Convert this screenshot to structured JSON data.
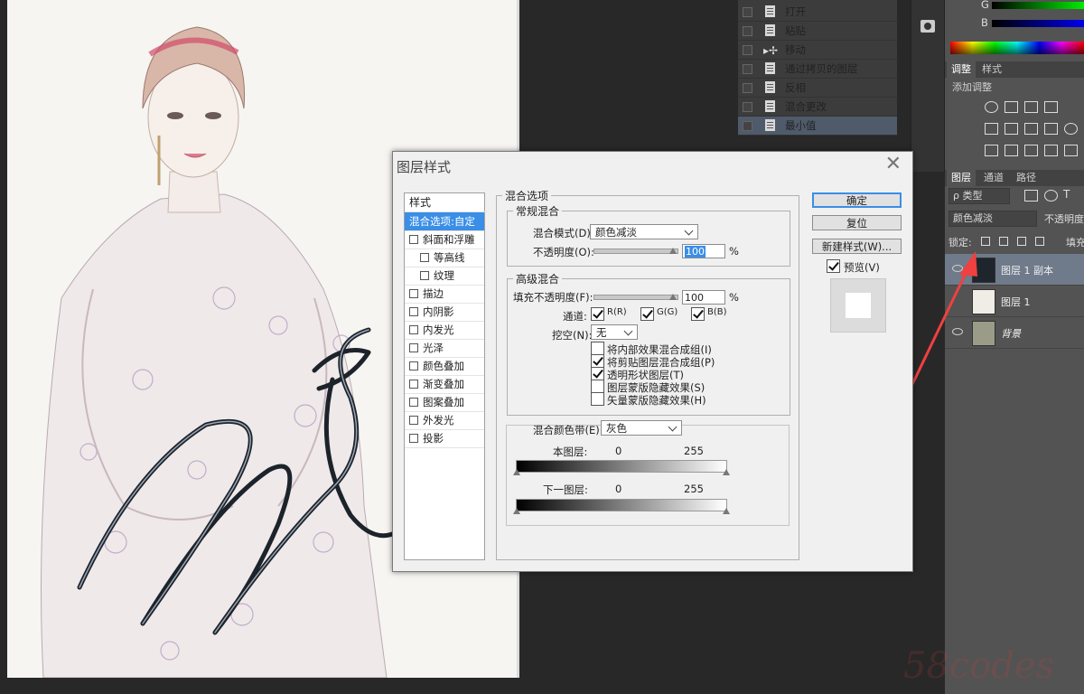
{
  "history": {
    "items": [
      {
        "label": "打开",
        "selected": false
      },
      {
        "label": "粘贴",
        "selected": false
      },
      {
        "label": "移动",
        "selected": false
      },
      {
        "label": "通过拷贝的图层",
        "selected": false
      },
      {
        "label": "反相",
        "selected": false
      },
      {
        "label": "混合更改",
        "selected": false
      },
      {
        "label": "最小值",
        "selected": true
      }
    ]
  },
  "color_panel": {
    "g_label": "G",
    "b_label": "B"
  },
  "adjustments": {
    "tab_adjust": "调整",
    "tab_style": "样式",
    "add_adjustment": "添加调整"
  },
  "layers": {
    "tabs": [
      "图层",
      "通道",
      "路径"
    ],
    "filter_kind": "ρ 类型",
    "blend_mode": "颜色减淡",
    "opacity_label": "不透明度",
    "lock_label": "锁定:",
    "fill_label": "填充",
    "items": [
      {
        "name": "图层 1 副本",
        "selected": true
      },
      {
        "name": "图层 1",
        "selected": false
      },
      {
        "name": "背景",
        "selected": false
      }
    ]
  },
  "dialog": {
    "title": "图层样式",
    "close": "✕",
    "style_list": {
      "header": "样式",
      "items": [
        {
          "label": "混合选项:自定",
          "selected": true,
          "checkbox": false,
          "indent": 0
        },
        {
          "label": "斜面和浮雕",
          "selected": false,
          "checkbox": true,
          "indent": 0
        },
        {
          "label": "等高线",
          "selected": false,
          "checkbox": true,
          "indent": 1
        },
        {
          "label": "纹理",
          "selected": false,
          "checkbox": true,
          "indent": 1
        },
        {
          "label": "描边",
          "selected": false,
          "checkbox": true,
          "indent": 0
        },
        {
          "label": "内阴影",
          "selected": false,
          "checkbox": true,
          "indent": 0
        },
        {
          "label": "内发光",
          "selected": false,
          "checkbox": true,
          "indent": 0
        },
        {
          "label": "光泽",
          "selected": false,
          "checkbox": true,
          "indent": 0
        },
        {
          "label": "颜色叠加",
          "selected": false,
          "checkbox": true,
          "indent": 0
        },
        {
          "label": "渐变叠加",
          "selected": false,
          "checkbox": true,
          "indent": 0
        },
        {
          "label": "图案叠加",
          "selected": false,
          "checkbox": true,
          "indent": 0
        },
        {
          "label": "外发光",
          "selected": false,
          "checkbox": true,
          "indent": 0
        },
        {
          "label": "投影",
          "selected": false,
          "checkbox": true,
          "indent": 0
        }
      ]
    },
    "blend_options": {
      "legend": "混合选项",
      "general": {
        "legend": "常规混合",
        "blend_mode_label": "混合模式(D):",
        "blend_mode_value": "颜色减淡",
        "opacity_label": "不透明度(O):",
        "opacity_value": "100",
        "percent": "%"
      },
      "advanced": {
        "legend": "高级混合",
        "fill_opacity_label": "填充不透明度(F):",
        "fill_opacity_value": "100",
        "percent": "%",
        "channels_label": "通道:",
        "channel_r": "R(R)",
        "channel_g": "G(G)",
        "channel_b": "B(B)",
        "knockout_label": "挖空(N):",
        "knockout_value": "无",
        "options": [
          {
            "label": "将内部效果混合成组(I)",
            "checked": false
          },
          {
            "label": "将剪贴图层混合成组(P)",
            "checked": true
          },
          {
            "label": "透明形状图层(T)",
            "checked": true
          },
          {
            "label": "图层蒙版隐藏效果(S)",
            "checked": false
          },
          {
            "label": "矢量蒙版隐藏效果(H)",
            "checked": false
          }
        ]
      },
      "blend_if": {
        "label": "混合颜色带(E):",
        "value": "灰色",
        "this_layer_label": "本图层:",
        "this_layer_min": "0",
        "this_layer_max": "255",
        "underlying_label": "下一图层:",
        "underlying_min": "0",
        "underlying_max": "255"
      }
    },
    "buttons": {
      "ok": "确定",
      "reset": "复位",
      "new_style": "新建样式(W)...",
      "preview": "预览(V)"
    }
  },
  "watermark": "58codes",
  "colors": {
    "selection_blue": "#3a8ee6",
    "annotation_arrow": "#f04040"
  }
}
